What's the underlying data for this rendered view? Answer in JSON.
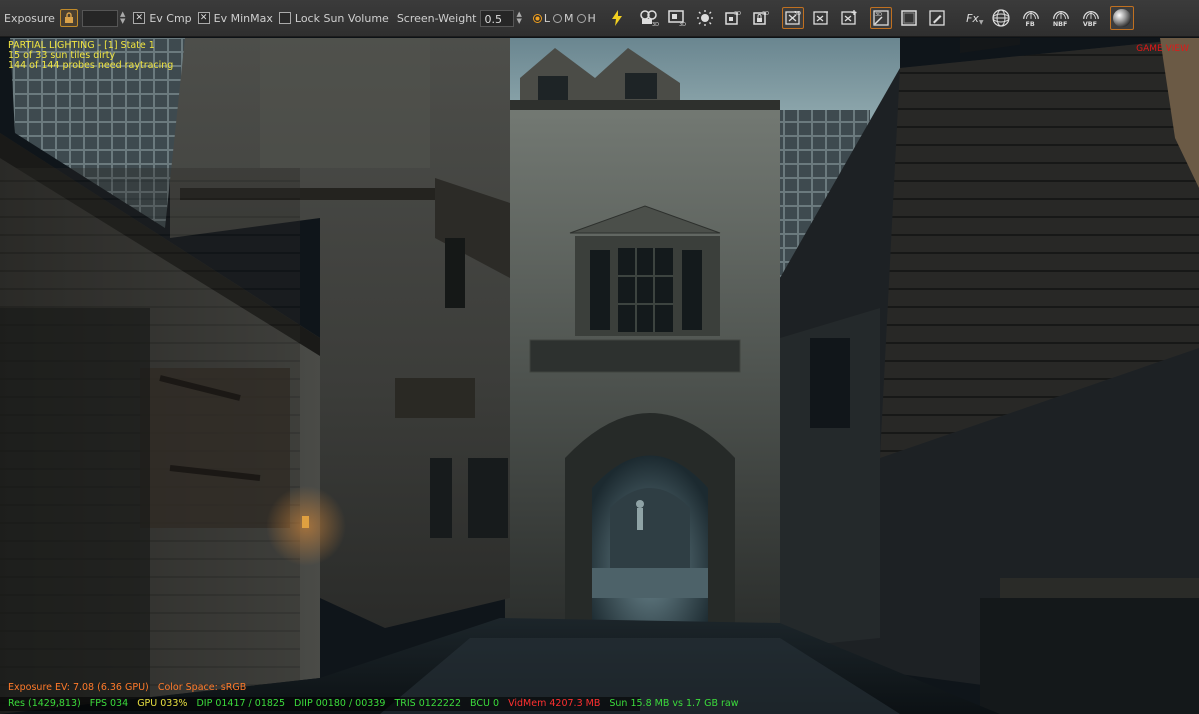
{
  "toolbar": {
    "exposure_label": "Exposure",
    "exposure_value": "",
    "ev_cmp_label": "Ev Cmp",
    "ev_cmp_checked": true,
    "ev_minmax_label": "Ev MinMax",
    "ev_minmax_checked": true,
    "lock_sun_label": "Lock Sun Volume",
    "lock_sun_checked": false,
    "screen_weight_label": "Screen-Weight",
    "screen_weight_value": "0.5",
    "quality_options": [
      "L",
      "M",
      "H"
    ],
    "quality_selected": "L",
    "fb_label": "FB",
    "nbf_label": "NBF",
    "vbf_label": "VBF",
    "fx_label": "Fx",
    "accent_color": "#f0a020"
  },
  "viewport": {
    "hud": {
      "line1": "PARTIAL LIGHTING - [1] State 1",
      "line2": "15 of 33 sun tiles dirty",
      "line3": "144 of 144 probes need raytracing"
    },
    "game_view_label": "GAME VIEW",
    "exposure_line": "Exposure EV: 7.08 (6.36 GPU)",
    "color_space": "Color Space: sRGB",
    "stats": {
      "res": "Res (1429,813)",
      "fps": "FPS 034",
      "gpu": "GPU 033%",
      "dip": "DIP 01417 / 01825",
      "diip": "DIIP 00180 / 00339",
      "tris": "TRIS 0122222",
      "bcu": "BCU 0",
      "vidmem": "VidMem 4207.3 MB",
      "sun": "Sun 15.8 MB vs 1.7 GB raw"
    },
    "colors": {
      "hud_yellow": "#f2e640",
      "game_view_red": "#e21818",
      "stat_green": "#3cdc3c",
      "stat_yellow": "#e8e040",
      "stat_red": "#ff3030",
      "exposure_orange": "#ff7a2a"
    }
  }
}
